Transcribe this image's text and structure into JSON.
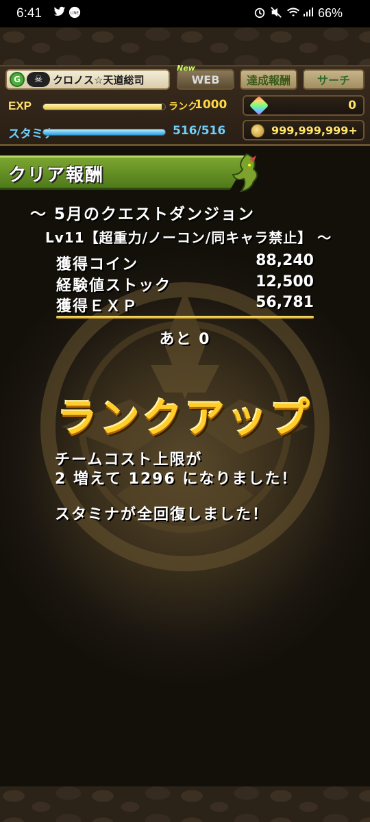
{
  "status_bar": {
    "time": "6:41",
    "left_icons": [
      "twitter-icon",
      "line-icon"
    ],
    "right_icons": [
      "alarm-icon",
      "mute-icon",
      "wifi-icon",
      "signal-icon"
    ],
    "battery": "66%"
  },
  "header": {
    "rank_badge_text": "G",
    "player_name": "クロノス☆天道総司",
    "new_label": "New",
    "web_label": "WEB",
    "achievement_label": "達成報酬",
    "search_label": "サーチ",
    "exp_label": "EXP",
    "exp_fill_fraction": 0.97,
    "rank_label": "ランク",
    "rank_value": "1000",
    "stamina_label": "スタミナ",
    "stamina_value": "516/516",
    "stamina_fill_fraction": 1.0,
    "magic_stones": "0",
    "coins": "999,999,999+"
  },
  "result": {
    "title": "クリア報酬",
    "dungeon_line1": "～ 5月のクエストダンジョン",
    "dungeon_line2": "Lv11【超重力/ノーコン/同キャラ禁止】 ～",
    "stats": {
      "coin_label": "獲得コイン",
      "coin_value": "88,240",
      "stock_label": "経験値ストック",
      "stock_value": "12,500",
      "exp_label": "獲得ＥＸＰ",
      "exp_value": "56,781"
    },
    "remaining": "あと 0",
    "rank_up": "ランクアップ",
    "message_line1": "チームコスト上限が",
    "message_line2": "2 増えて 1296 になりました！",
    "message_line3": "スタミナが全回復しました！"
  },
  "colors": {
    "accent_gold": "#ffce2a",
    "title_bar_green": "#6a9428",
    "stamina_blue": "#6fd0ff",
    "exp_yellow": "#ffe36a"
  }
}
